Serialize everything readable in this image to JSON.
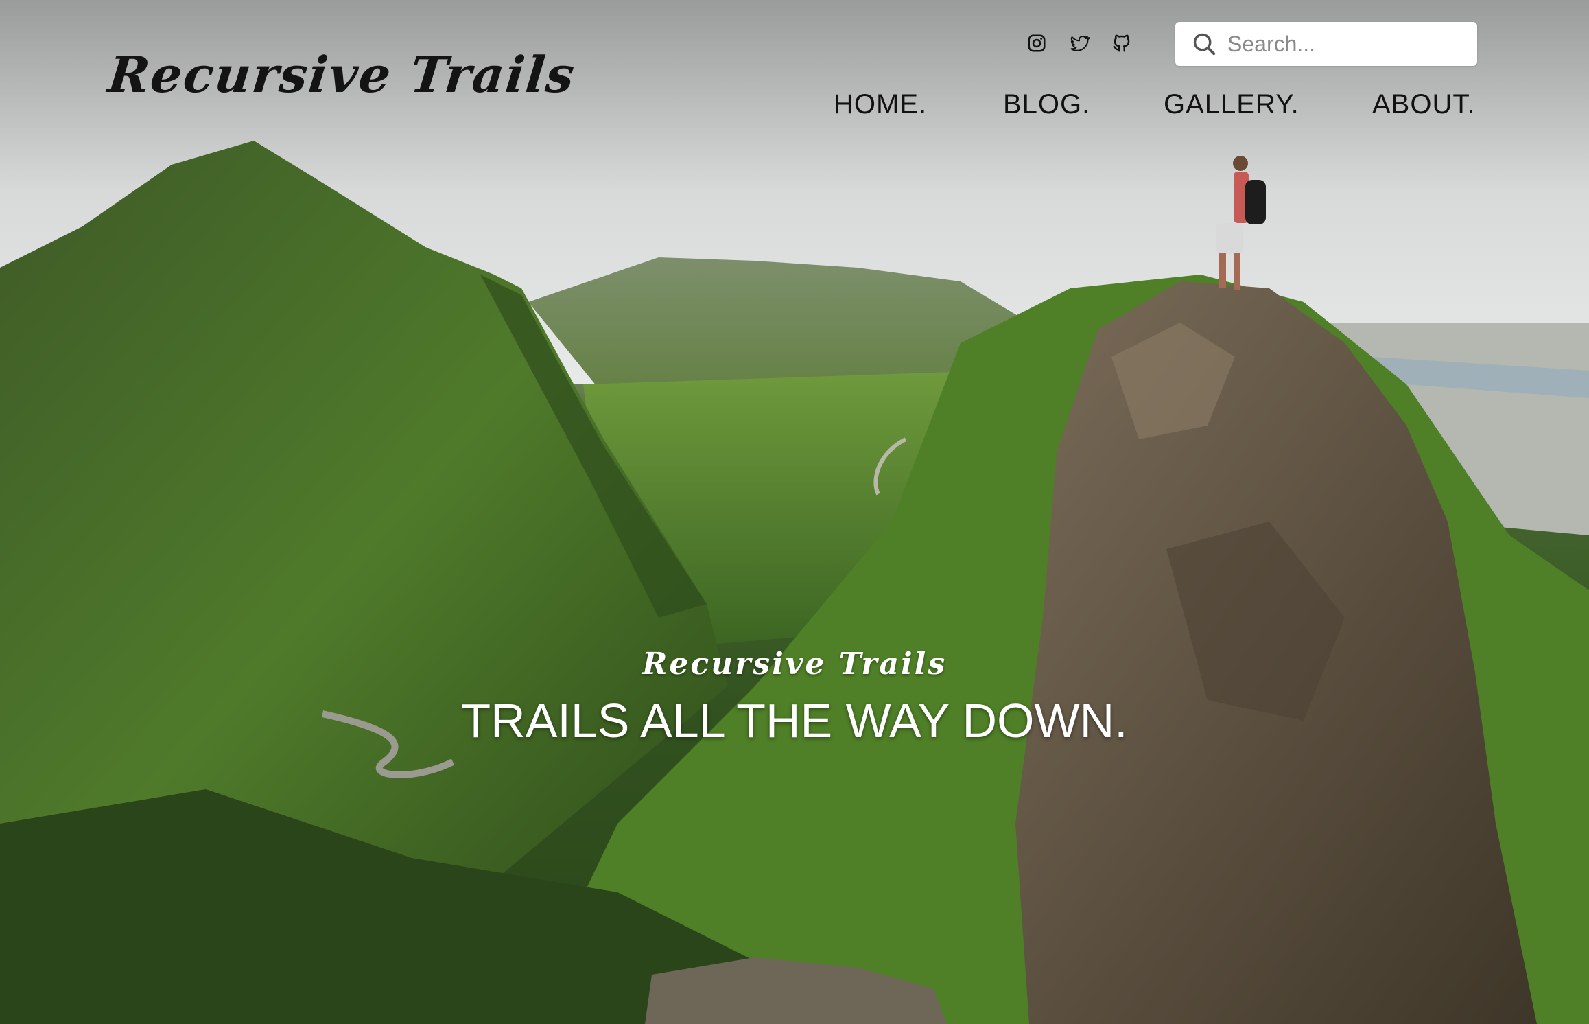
{
  "site": {
    "brand": "Recursive Trails"
  },
  "header": {
    "social": [
      {
        "name": "instagram-icon"
      },
      {
        "name": "twitter-icon"
      },
      {
        "name": "github-icon"
      }
    ],
    "search": {
      "placeholder": "Search..."
    }
  },
  "nav": {
    "items": [
      {
        "label": "HOME."
      },
      {
        "label": "BLOG."
      },
      {
        "label": "GALLERY."
      },
      {
        "label": "ABOUT."
      }
    ]
  },
  "hero": {
    "script_title": "Recursive Trails",
    "headline": "TRAILS ALL THE WAY DOWN."
  },
  "colors": {
    "text_dark": "#111111",
    "text_light": "#ffffff",
    "search_bg": "#ffffff"
  }
}
